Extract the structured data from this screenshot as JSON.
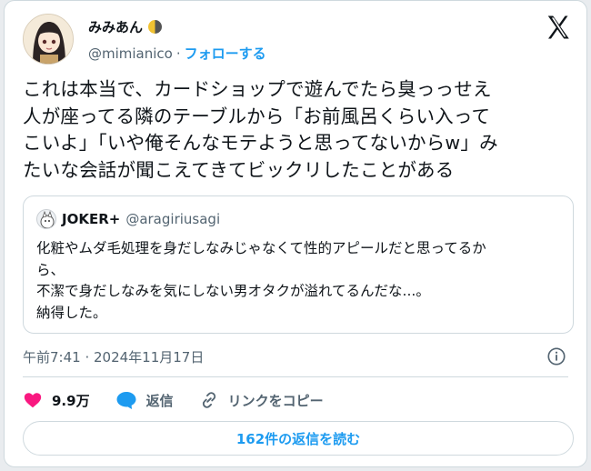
{
  "author": {
    "display_name": "みみあん",
    "handle": "@mimianico",
    "separator": "·",
    "follow_label": "フォローする"
  },
  "tweet": {
    "lines": [
      "これは本当で、カードショップで遊んでたら臭っっせえ",
      "人が座ってる隣のテーブルから「お前風呂くらい入って",
      "こいよ」「いや俺そんなモテようと思ってないからw」み",
      "たいな会話が聞こえてきてビックリしたことがある"
    ]
  },
  "quote": {
    "name": "JOKER+",
    "handle": "@aragiriusagi",
    "lines": [
      "化粧やムダ毛処理を身だしなみじゃなくて性的アピールだと思ってるか",
      "ら、",
      "不潔で身だしなみを気にしない男オタクが溢れてるんだな...。",
      "納得した。"
    ]
  },
  "meta": {
    "timestamp": "午前7:41 · 2024年11月17日"
  },
  "actions": {
    "like_count": "9.9万",
    "reply_label": "返信",
    "copy_link_label": "リンクをコピー"
  },
  "read_replies_label": "162件の返信を読む",
  "colors": {
    "accent": "#1d9bf0",
    "like": "#f91880",
    "text": "#0f1419",
    "muted": "#536471",
    "border": "#cfd9de"
  },
  "icons": {
    "moon": "half-moon-emoji",
    "logo": "x-logo-icon",
    "info": "info-icon",
    "like": "heart-icon",
    "reply": "speech-bubble-icon",
    "link": "link-icon"
  }
}
